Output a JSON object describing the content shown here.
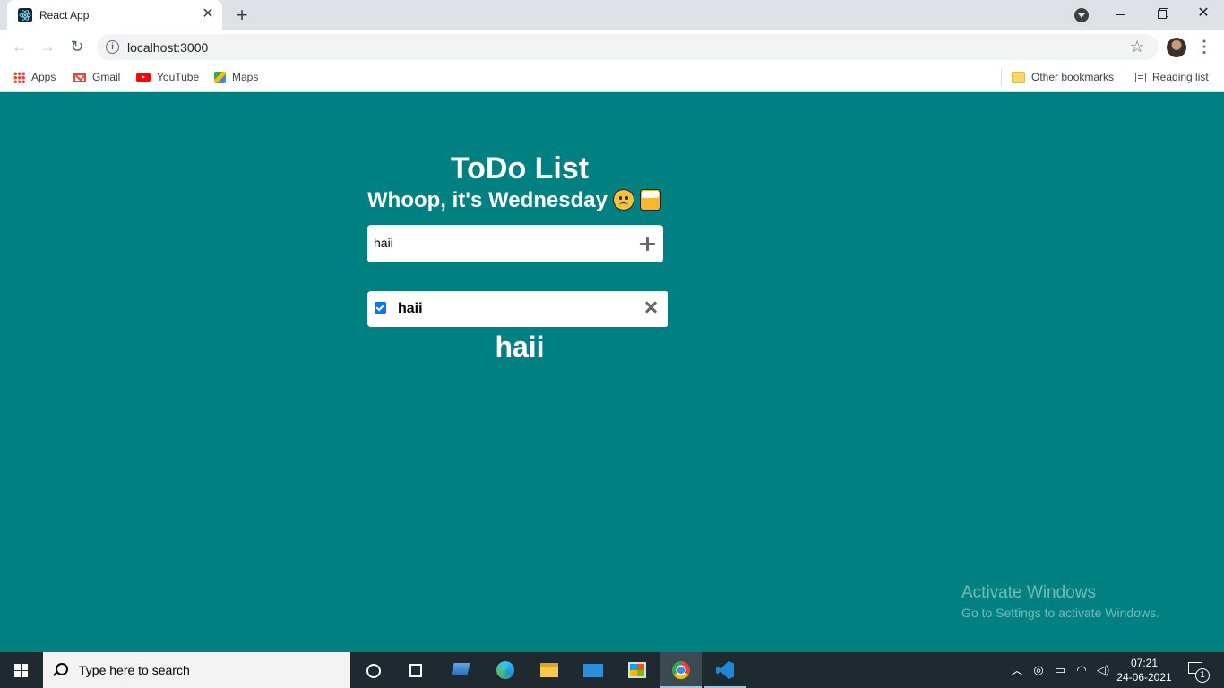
{
  "browser": {
    "tab_title": "React App",
    "url": "localhost:3000",
    "bookmarks": {
      "apps": "Apps",
      "gmail": "Gmail",
      "youtube": "YouTube",
      "maps": "Maps",
      "other": "Other bookmarks",
      "reading_list": "Reading list"
    }
  },
  "app": {
    "title": "ToDo List",
    "subtitle": "Whoop, it's Wednesday",
    "input_value": "haii",
    "todos": [
      {
        "text": "haii",
        "checked": true
      }
    ],
    "display_text": "haii",
    "background_color": "#008080"
  },
  "watermark": {
    "title": "Activate Windows",
    "subtitle": "Go to Settings to activate Windows."
  },
  "taskbar": {
    "search_placeholder": "Type here to search",
    "time": "07:21",
    "date": "24-06-2021",
    "notification_count": "1"
  }
}
